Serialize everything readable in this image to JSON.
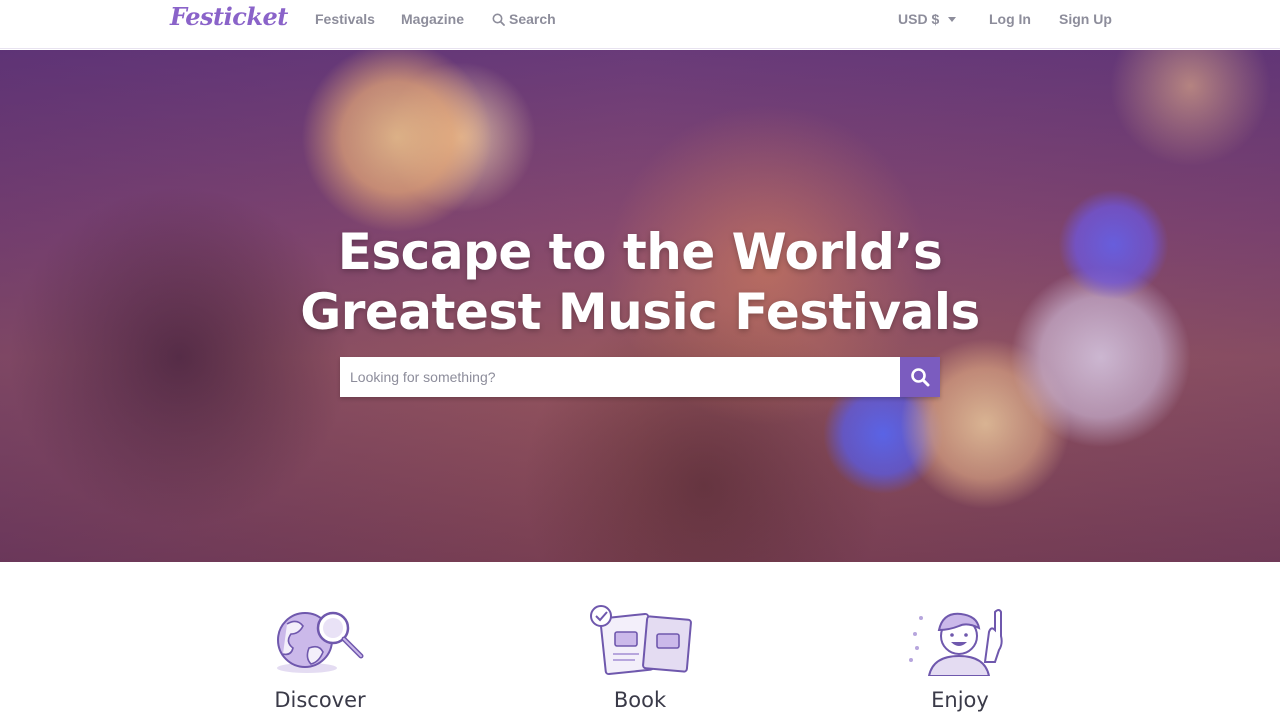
{
  "nav": {
    "logo": "Festicket",
    "links": {
      "festivals": "Festivals",
      "magazine": "Magazine",
      "search": "Search",
      "currency": "USD $",
      "login": "Log In",
      "signup": "Sign Up"
    }
  },
  "hero": {
    "title_line1": "Escape to the World’s",
    "title_line2": "Greatest Music Festivals",
    "search_placeholder": "Looking for something?"
  },
  "features": [
    {
      "label": "Discover",
      "icon": "globe-magnifier-icon"
    },
    {
      "label": "Book",
      "icon": "tickets-icon"
    },
    {
      "label": "Enjoy",
      "icon": "happy-person-icon"
    }
  ],
  "colors": {
    "brand": "#8a63c9",
    "search_button": "#7b5cbf",
    "nav_text": "#8d8d9b"
  }
}
